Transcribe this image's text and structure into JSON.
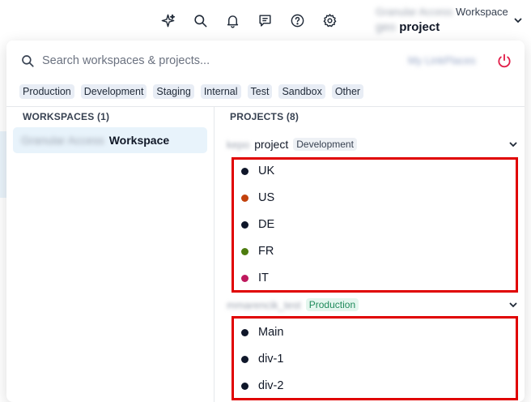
{
  "topbar": {
    "icons": [
      "sparkle-icon",
      "search-icon",
      "bell-icon",
      "chat-icon",
      "help-icon",
      "gear-icon"
    ],
    "workspace_switcher": {
      "line1_prefix": "Granular Access",
      "line1_name": "Workspace",
      "line2_prefix": "geo",
      "line2_name": "project"
    }
  },
  "search": {
    "placeholder": "Search workspaces & projects...",
    "account_link": "My LinkPlaces"
  },
  "filters": [
    "Production",
    "Development",
    "Staging",
    "Internal",
    "Test",
    "Sandbox",
    "Other"
  ],
  "workspaces": {
    "header": "WORKSPACES (1)",
    "items": [
      {
        "prefix": "Granular Access",
        "name": "Workspace"
      }
    ]
  },
  "projects": {
    "header": "PROJECTS (8)",
    "groups": [
      {
        "prefix": "kepo",
        "name": "project",
        "tag": "Development",
        "items": [
          {
            "label": "UK",
            "color": "#0f172a"
          },
          {
            "label": "US",
            "color": "#c2410c"
          },
          {
            "label": "DE",
            "color": "#0f172a"
          },
          {
            "label": "FR",
            "color": "#4d7c0f"
          },
          {
            "label": "IT",
            "color": "#be185d"
          }
        ]
      },
      {
        "prefix": "mmarencik_test",
        "name": "",
        "tag": "Production",
        "items": [
          {
            "label": "Main",
            "color": "#0f172a"
          },
          {
            "label": "div-1",
            "color": "#0f172a"
          },
          {
            "label": "div-2",
            "color": "#0f172a"
          }
        ]
      }
    ]
  },
  "colors": {
    "accent": "#e8f3fb",
    "highlight": "#e00000",
    "power": "#e11d48"
  }
}
